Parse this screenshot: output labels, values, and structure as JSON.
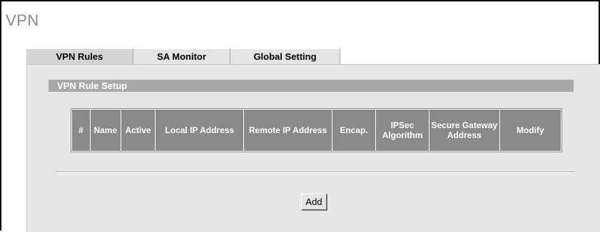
{
  "page": {
    "title": "VPN"
  },
  "tabs": [
    {
      "label": "VPN Rules",
      "active": true
    },
    {
      "label": "SA Monitor",
      "active": false
    },
    {
      "label": "Global Setting",
      "active": false
    }
  ],
  "section": {
    "title": "VPN Rule Setup"
  },
  "table": {
    "columns": [
      "#",
      "Name",
      "Active",
      "Local IP Address",
      "Remote IP Address",
      "Encap.",
      "IPSec Algorithm",
      "Secure Gateway Address",
      "Modify"
    ],
    "rows": []
  },
  "actions": {
    "add_label": "Add"
  },
  "colors": {
    "title_gray": "#8a8a8a",
    "panel_bg": "#e6e6e6",
    "section_bar": "#a9a9a9",
    "header_cell": "#8a8a8a",
    "tab_bg": "#e4e4e4"
  }
}
